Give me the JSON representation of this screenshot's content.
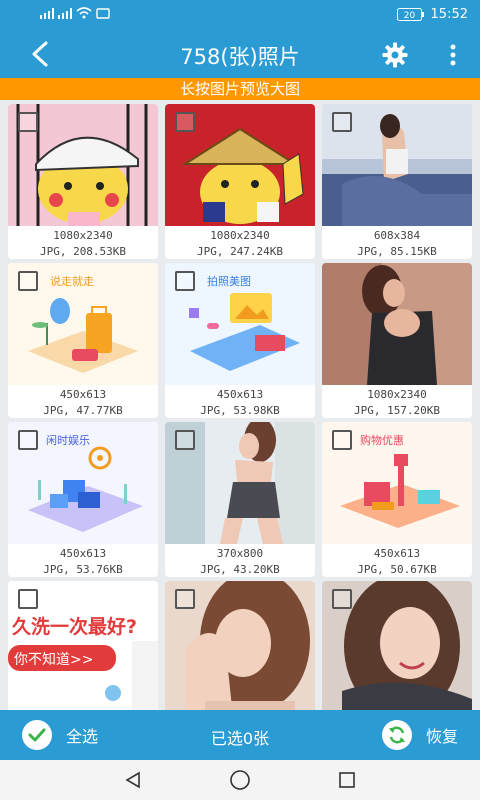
{
  "status_bar": {
    "time": "15:52",
    "battery": "20"
  },
  "header": {
    "title": "758(张)照片",
    "back_icon": "back-arrow-icon",
    "settings_icon": "gear-icon",
    "more_icon": "more-vert-icon"
  },
  "banner": {
    "text": "长按图片预览大图"
  },
  "photos": [
    {
      "dimensions": "1080x2340",
      "info": "JPG, 208.53KB",
      "subject": "pikachu-cap"
    },
    {
      "dimensions": "1080x2340",
      "info": "JPG, 247.24KB",
      "subject": "pikachu-hat"
    },
    {
      "dimensions": "608x384",
      "info": "JPG, 85.15KB",
      "subject": "woman-bed"
    },
    {
      "dimensions": "450x613",
      "info": "JPG, 47.77KB",
      "subject": "travel-illustration"
    },
    {
      "dimensions": "450x613",
      "info": "JPG, 53.98KB",
      "subject": "photo-illustration"
    },
    {
      "dimensions": "1080x2340",
      "info": "JPG, 157.20KB",
      "subject": "woman-dress"
    },
    {
      "dimensions": "450x613",
      "info": "JPG, 53.76KB",
      "subject": "game-illustration"
    },
    {
      "dimensions": "370x800",
      "info": "JPG, 43.20KB",
      "subject": "woman-skirt"
    },
    {
      "dimensions": "450x613",
      "info": "JPG, 50.67KB",
      "subject": "shopping-illustration"
    },
    {
      "dimensions": "",
      "info": "",
      "subject": "text-ad",
      "ad_line1": "久洗一次最好?",
      "ad_line2": "你不知道>>"
    },
    {
      "dimensions": "",
      "info": "",
      "subject": "woman-portrait"
    },
    {
      "dimensions": "",
      "info": "",
      "subject": "woman-smile"
    }
  ],
  "action_bar": {
    "select_all_label": "全选",
    "selected_count": "已选0张",
    "restore_label": "恢复",
    "select_all_icon": "check-circle-icon",
    "restore_icon": "refresh-icon"
  },
  "colors": {
    "primary": "#2b9bd4",
    "banner": "#ff9800",
    "check_green": "#3bb54a"
  }
}
